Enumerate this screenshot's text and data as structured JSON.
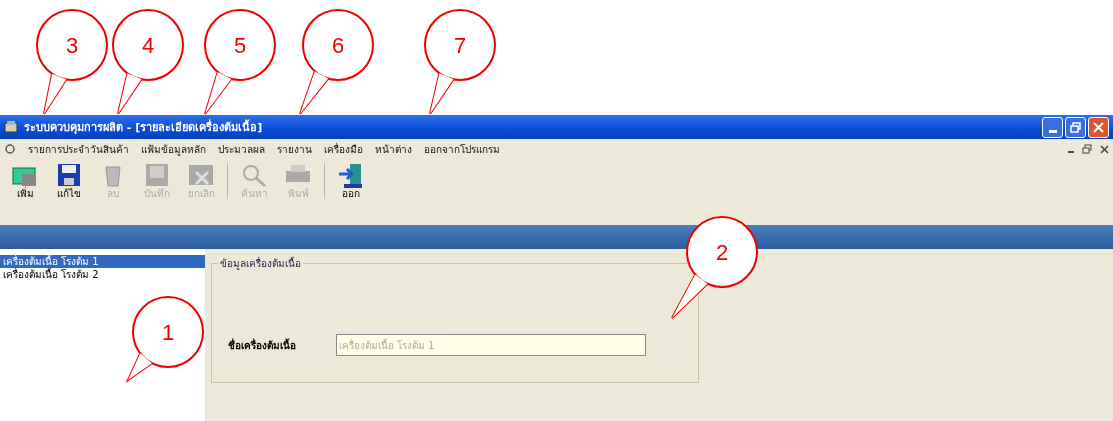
{
  "window": {
    "title": "ระบบควบคุมการผลิต - [รายละเอียดเครื่องต้มเนื้อ]"
  },
  "menu": [
    "รายการประจำวันสินค้า",
    "แฟ้มข้อมูลหลัก",
    "ประมวลผล",
    "รายงาน",
    "เครื่องมือ",
    "หน้าต่าง",
    "ออกจากโปรแกรม"
  ],
  "toolbar": [
    {
      "kind": "add",
      "label": "เพิ่ม",
      "disabled": false
    },
    {
      "kind": "edit",
      "label": "แก้ไข",
      "disabled": false
    },
    {
      "kind": "delete",
      "label": "ลบ",
      "disabled": true
    },
    {
      "kind": "save",
      "label": "บันทึก",
      "disabled": true
    },
    {
      "kind": "cancel",
      "label": "ยกเลิก",
      "disabled": true
    },
    {
      "kind": "search",
      "label": "ค้นหา",
      "disabled": true
    },
    {
      "kind": "print",
      "label": "พิมพ์",
      "disabled": true
    },
    {
      "kind": "exit",
      "label": "ออก",
      "disabled": false
    }
  ],
  "list": [
    {
      "label": "เครื่องต้มเนื้อ โรงต้ม 1",
      "selected": true
    },
    {
      "label": "เครื่องต้มเนื้อ โรงต้ม 2",
      "selected": false
    }
  ],
  "detail": {
    "group_title": "ข้อมูลเครื่องต้มเนื้อ",
    "field_label": "ชื่อเครื่องต้มเนื้อ",
    "field_value": "เครื่องต้มเนื้อ โรงต้ม 1"
  },
  "callouts": [
    "3",
    "4",
    "5",
    "6",
    "7",
    "1",
    "2"
  ]
}
